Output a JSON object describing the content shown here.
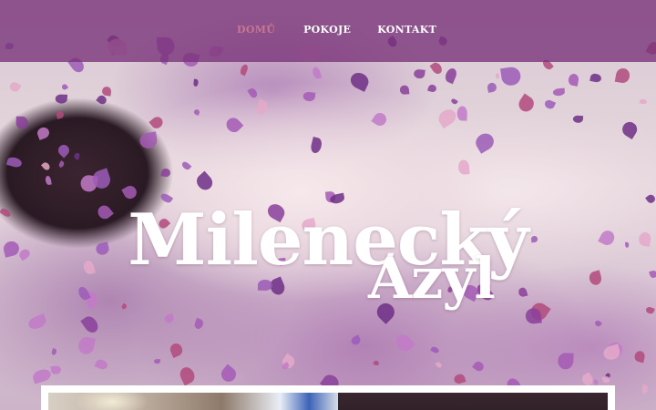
{
  "nav": {
    "items": [
      {
        "label": "DOMŮ",
        "active": true
      },
      {
        "label": "POKOJE",
        "active": false
      },
      {
        "label": "KONTAKT",
        "active": false
      }
    ]
  },
  "hero": {
    "title_line1": "Milenecký",
    "title_line2": "Azyl",
    "image": "woman-in-flower-petals-photo"
  },
  "colors": {
    "nav_background": "#7a327a",
    "nav_active": "#c9768f",
    "nav_text": "#ffffff",
    "title_text": "#ffffff"
  }
}
